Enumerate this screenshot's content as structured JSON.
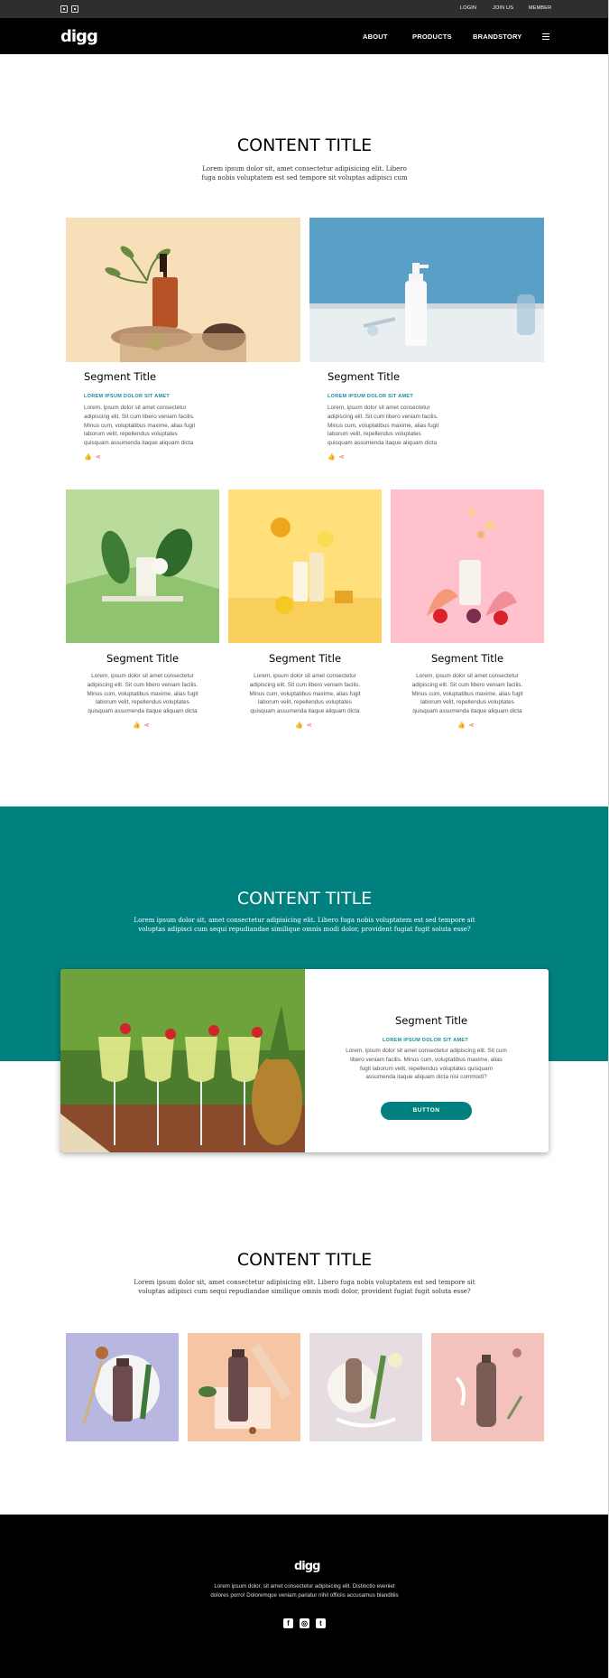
{
  "topbar": {
    "links": [
      "LOGIN",
      "JOIN US",
      "MEMBER"
    ]
  },
  "navbar": {
    "logo": "digg",
    "items": [
      "ABOUT",
      "PRODUCTS",
      "BRANDSTORY"
    ]
  },
  "section1": {
    "title": "CONTENT TITLE",
    "desc_line1": "Lorem ipsum dolor sit, amet consectetur adipisicing elit. Libero",
    "desc_line2": "fuga nobis voluptatem est sed tempore sit voluptas adipisci cum",
    "wide_cards": [
      {
        "title": "Segment Title",
        "subtitle": "LOREM IPSUM DOLOR SIT AMET",
        "text": [
          "Lorem, ipsum dolor sit amet consectetur",
          "adipiscing elit. Sit cum libero veniam facilis.",
          "Minus cum, voluptatibus maxime, alias fugit",
          "laborum velit, repellendus voluptates",
          "quisquam assumenda itaque aliquam dicta"
        ]
      },
      {
        "title": "Segment Title",
        "subtitle": "LOREM IPSUM DOLOR SIT AMET",
        "text": [
          "Lorem, ipsum dolor sit amet consectetur",
          "adipiscing elit. Sit cum libero veniam facilis.",
          "Minus cum, voluptatibus maxime, alias fugit",
          "laborum velit, repellendus voluptates",
          "quisquam assumenda itaque aliquam dicta"
        ]
      }
    ],
    "small_cards": [
      {
        "title": "Segment Title",
        "text": [
          "Lorem, ipsum dolor sit amet consectetur",
          "adipiscing elit. Sit cum libero veniam facilis.",
          "Minus cum, voluptatibus maxime, alias fugit",
          "laborum velit, repellendus voluptates",
          "quisquam assumenda itaque aliquam dicta"
        ]
      },
      {
        "title": "Segment Title",
        "text": [
          "Lorem, ipsum dolor sit amet consectetur",
          "adipiscing elit. Sit cum libero veniam facilis.",
          "Minus cum, voluptatibus maxime, alias fugit",
          "laborum velit, repellendus voluptates",
          "quisquam assumenda itaque aliquam dicta"
        ]
      },
      {
        "title": "Segment Title",
        "text": [
          "Lorem, ipsum dolor sit amet consectetur",
          "adipiscing elit. Sit cum libero veniam facilis.",
          "Minus cum, voluptatibus maxime, alias fugit",
          "laborum velit, repellendus voluptates",
          "quisquam assumenda itaque aliquam dicta"
        ]
      }
    ]
  },
  "section2": {
    "title": "CONTENT TITLE",
    "desc_line1": "Lorem ipsum dolor sit, amet consectetur adipisicing elit. Libero fuga nobis voluptatem est sed tempore sit",
    "desc_line2": "voluptas adipisci cum sequi repudiandae similique omnis modi dolor, provident fugiat fugit soluta esse?",
    "card": {
      "title": "Segment Title",
      "subtitle": "LOREM IPSUM DOLOR SIT AMET",
      "text": [
        "Lorem, ipsum dolor sit amet consectetur adipiscing elit. Sit cum",
        "libero veniam facilis. Minus cum, voluptatibus maxime, alias",
        "fugit laborum velit, repellendus voluptates quisquam",
        "assumenda itaque aliquam dicta nisi commodi?"
      ],
      "button": "BUTTON"
    }
  },
  "section3": {
    "title": "CONTENT TITLE",
    "desc_line1": "Lorem ipsum dolor sit, amet consectetur adipisicing elit. Libero fuga nobis voluptatem est sed tempore sit",
    "desc_line2": "voluptas adipisci cum sequi repudiandae similique omnis modi dolor, provident fugiat fugit soluta esse?"
  },
  "footer": {
    "logo": "digg",
    "line1": "Lorem ipsum dolor, sit amet consectetur adipisicing elit. Distinctio eveniet",
    "line2": "dolores porro! Doloremque veniam pariatur nihil officiis accusamus blanditiis",
    "social": [
      "facebook-icon",
      "instagram-icon",
      "twitter-icon"
    ]
  },
  "colors": {
    "accent": "#00817f",
    "link_blue": "#1b8a9e",
    "icon_red": "#e3553a"
  }
}
